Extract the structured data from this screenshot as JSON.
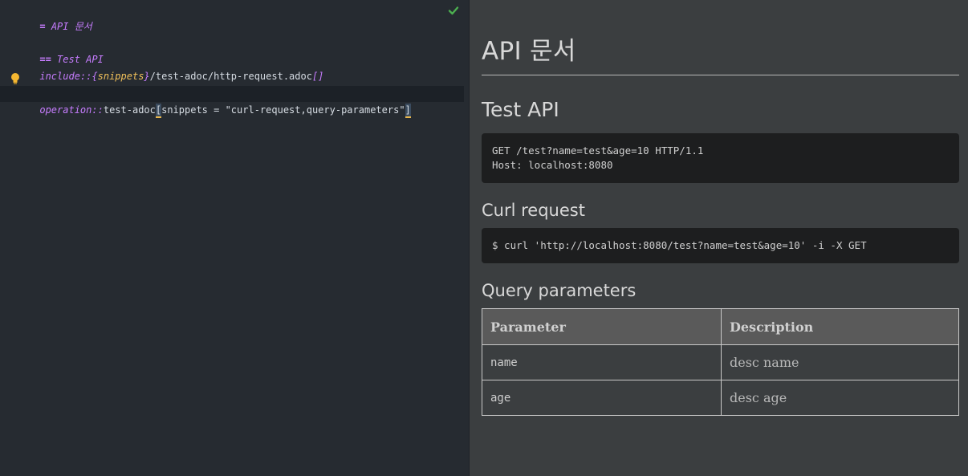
{
  "editor": {
    "line1": {
      "mark": "=",
      "text": " API 문서"
    },
    "line2": {
      "mark": "==",
      "text": " Test API"
    },
    "line3": {
      "prefix": "include::",
      "attr_open": "{",
      "attr": "snippets",
      "attr_close": "}",
      "path": "/test-adoc/http-request.adoc",
      "brackets": "[]"
    },
    "line4": {
      "prefix": "operation::",
      "target": "test-adoc",
      "open": "[",
      "args": "snippets = \"curl-request,query-parameters\"",
      "close": "]"
    },
    "icons": {
      "status": "check-icon",
      "hint": "lightbulb-icon"
    },
    "colors": {
      "keyword": "#c77dff",
      "attribute": "#f0c05a",
      "check": "#4caf50",
      "bulb": "#f5b731"
    }
  },
  "preview": {
    "title": "API 문서",
    "section": "Test API",
    "http_request": "GET /test?name=test&age=10 HTTP/1.1\nHost: localhost:8080",
    "curl_heading": "Curl request",
    "curl_code": "$ curl 'http://localhost:8080/test?name=test&age=10' -i -X GET",
    "query_heading": "Query parameters",
    "table": {
      "headers": [
        "Parameter",
        "Description"
      ],
      "rows": [
        {
          "param": "name",
          "desc": "desc name"
        },
        {
          "param": "age",
          "desc": "desc age"
        }
      ]
    }
  }
}
